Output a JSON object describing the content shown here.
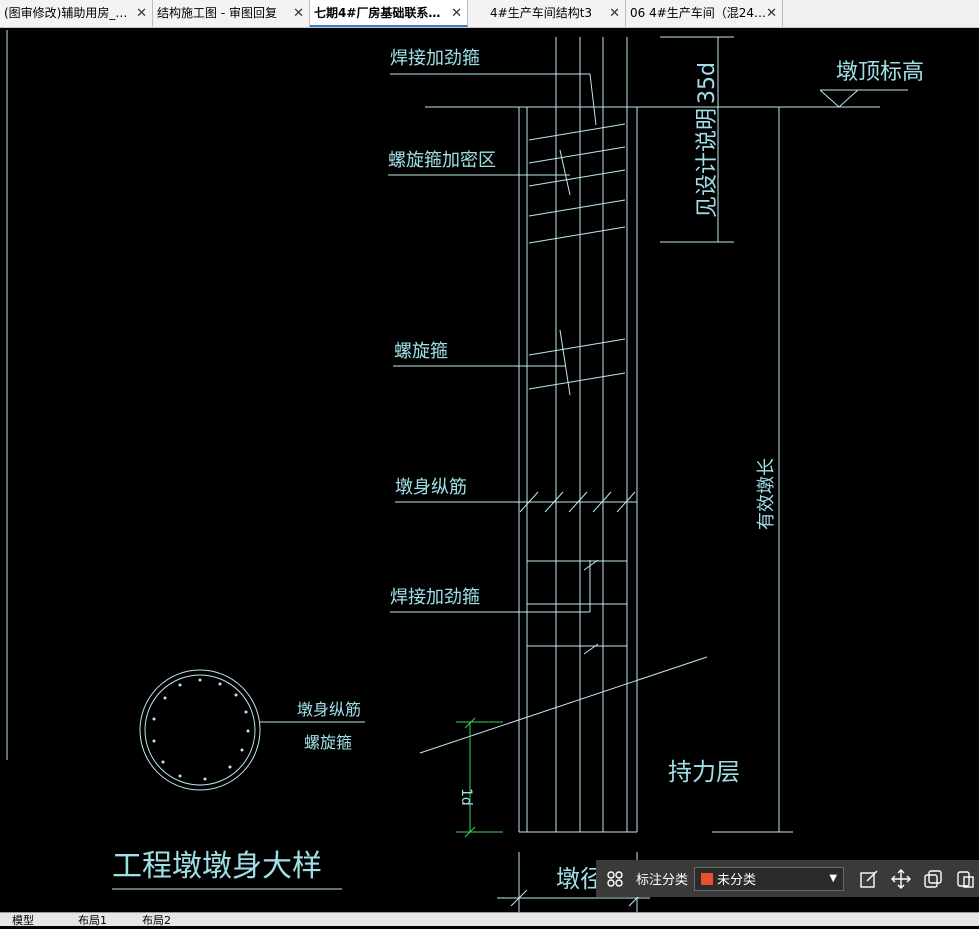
{
  "tabs": [
    {
      "label": "(图审修改)辅助用房_…",
      "active": false
    },
    {
      "label": "结构施工图 - 审图回复",
      "active": false
    },
    {
      "label": "七期4#厂房基础联系…",
      "active": true
    },
    {
      "label": "4#生产车间结构t3",
      "active": false
    },
    {
      "label": "06 4#生产车间（混24…",
      "active": false
    }
  ],
  "drawing": {
    "labels": {
      "weld_top": "焊接加劲箍",
      "spiral_dense": "螺旋箍加密区",
      "spiral": "螺旋箍",
      "long_bar": "墩身纵筋",
      "weld_bottom": "焊接加劲箍",
      "top_elev": "墩顶标高",
      "anchor_len": "35d",
      "see_note": "见设计说明",
      "effective_len": "有效墩长",
      "bearing": "持力层",
      "embed": "1d",
      "diameter": "墩径",
      "section_bar": "墩身纵筋",
      "section_spiral": "螺旋箍",
      "title": "工程墩墩身大样"
    }
  },
  "toolbar": {
    "category_label": "标注分类",
    "category_value": "未分类",
    "category_color": "#e8502a"
  },
  "layout_tabs": [
    "模型",
    "布局1",
    "布局2"
  ],
  "colors": {
    "line": "#bfe8f0",
    "text": "#9fe0e8",
    "green": "#39d65a"
  }
}
